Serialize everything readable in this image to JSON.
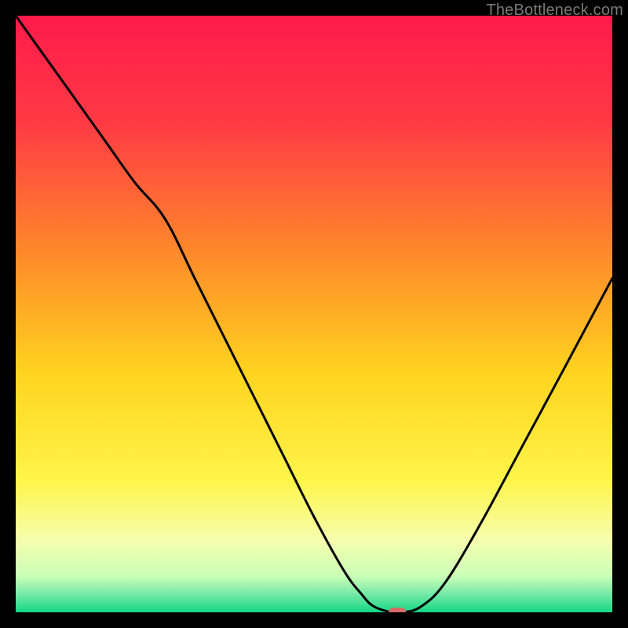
{
  "watermark": {
    "text": "TheBottleneck.com"
  },
  "chart_data": {
    "type": "line",
    "title": "",
    "xlabel": "",
    "ylabel": "",
    "xlim": [
      0,
      100
    ],
    "ylim": [
      0,
      100
    ],
    "grid": false,
    "legend": false,
    "background_gradient": {
      "stops": [
        {
          "pct": 0,
          "color": "#ff1a4b"
        },
        {
          "pct": 18,
          "color": "#ff3a44"
        },
        {
          "pct": 40,
          "color": "#ff8a2a"
        },
        {
          "pct": 60,
          "color": "#ffd41f"
        },
        {
          "pct": 78,
          "color": "#fff54a"
        },
        {
          "pct": 88,
          "color": "#f6ffae"
        },
        {
          "pct": 94,
          "color": "#c9ffb8"
        },
        {
          "pct": 97,
          "color": "#73e9a6"
        },
        {
          "pct": 100,
          "color": "#14d784"
        }
      ]
    },
    "series": [
      {
        "name": "bottleneck-curve",
        "color": "#000000",
        "x": [
          0,
          5,
          10,
          15,
          20,
          25,
          30,
          35,
          40,
          45,
          50,
          55,
          58,
          60,
          63,
          65,
          68,
          72,
          78,
          85,
          92,
          100
        ],
        "y": [
          100,
          93,
          86,
          79,
          72,
          66,
          56,
          46,
          36,
          26,
          16,
          7,
          3,
          1,
          0,
          0,
          1,
          5,
          15,
          28,
          41,
          56
        ]
      }
    ],
    "annotations": [
      {
        "name": "optimal-marker",
        "x": 64,
        "y": 0,
        "shape": "pill",
        "color": "#d86a6a"
      }
    ]
  }
}
